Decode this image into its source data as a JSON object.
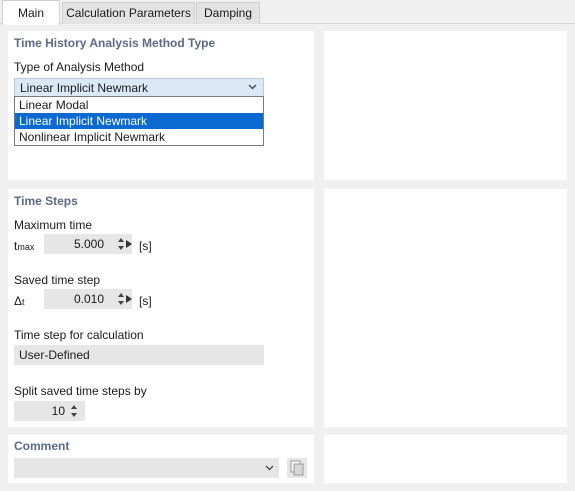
{
  "tabs": [
    {
      "label": "Main",
      "active": true
    },
    {
      "label": "Calculation Parameters",
      "active": false
    },
    {
      "label": "Damping",
      "active": false
    }
  ],
  "method_section": {
    "title": "Time History Analysis Method Type",
    "type_label": "Type of Analysis Method",
    "selected_value": "Linear Implicit Newmark",
    "options": [
      "Linear Modal",
      "Linear Implicit Newmark",
      "Nonlinear Implicit Newmark"
    ],
    "highlighted_option": "Linear Implicit Newmark"
  },
  "time_steps": {
    "title": "Time Steps",
    "max_time_label": "Maximum time",
    "tmax_symbol": "t",
    "tmax_sub": "max",
    "tmax_value": "5.000",
    "tmax_unit": "[s]",
    "saved_step_label": "Saved time step",
    "dt_symbol": "Δ",
    "dt_sub": "t",
    "dt_value": "0.010",
    "dt_unit": "[s]",
    "calc_step_label": "Time step for calculation",
    "calc_step_value": "User-Defined",
    "split_label": "Split saved time steps by",
    "split_value": "10"
  },
  "comment": {
    "title": "Comment",
    "value": ""
  },
  "colors": {
    "section_title": "#5a6a85",
    "dropdown_bg": "#dbe9f7",
    "selection": "#0a6ad1",
    "field_bg": "#e6e6e6"
  }
}
